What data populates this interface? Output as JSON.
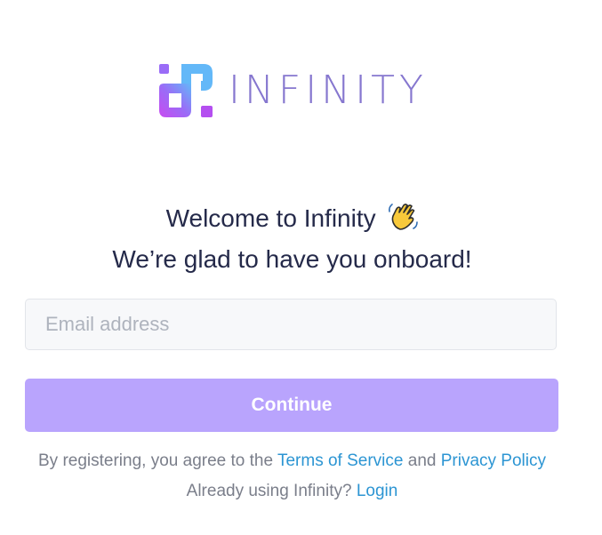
{
  "brand": {
    "name": "INFINITY",
    "logo_icon": "infinity-logo-icon",
    "text_color": "#8677cf"
  },
  "welcome": {
    "line1": "Welcome to Infinity",
    "line1_icon": "waving-hand-icon",
    "line2": "We’re glad to have you onboard!"
  },
  "form": {
    "email_placeholder": "Email address",
    "email_value": "",
    "continue_label": "Continue",
    "continue_color": "#b9a4fd"
  },
  "legal": {
    "prefix": "By registering, you agree to the",
    "terms_link": "Terms of Service",
    "and": "and",
    "privacy_link": "Privacy Policy",
    "already_text": "Already using Infinity?",
    "login_link": "Login",
    "link_color": "#2c95d3"
  }
}
